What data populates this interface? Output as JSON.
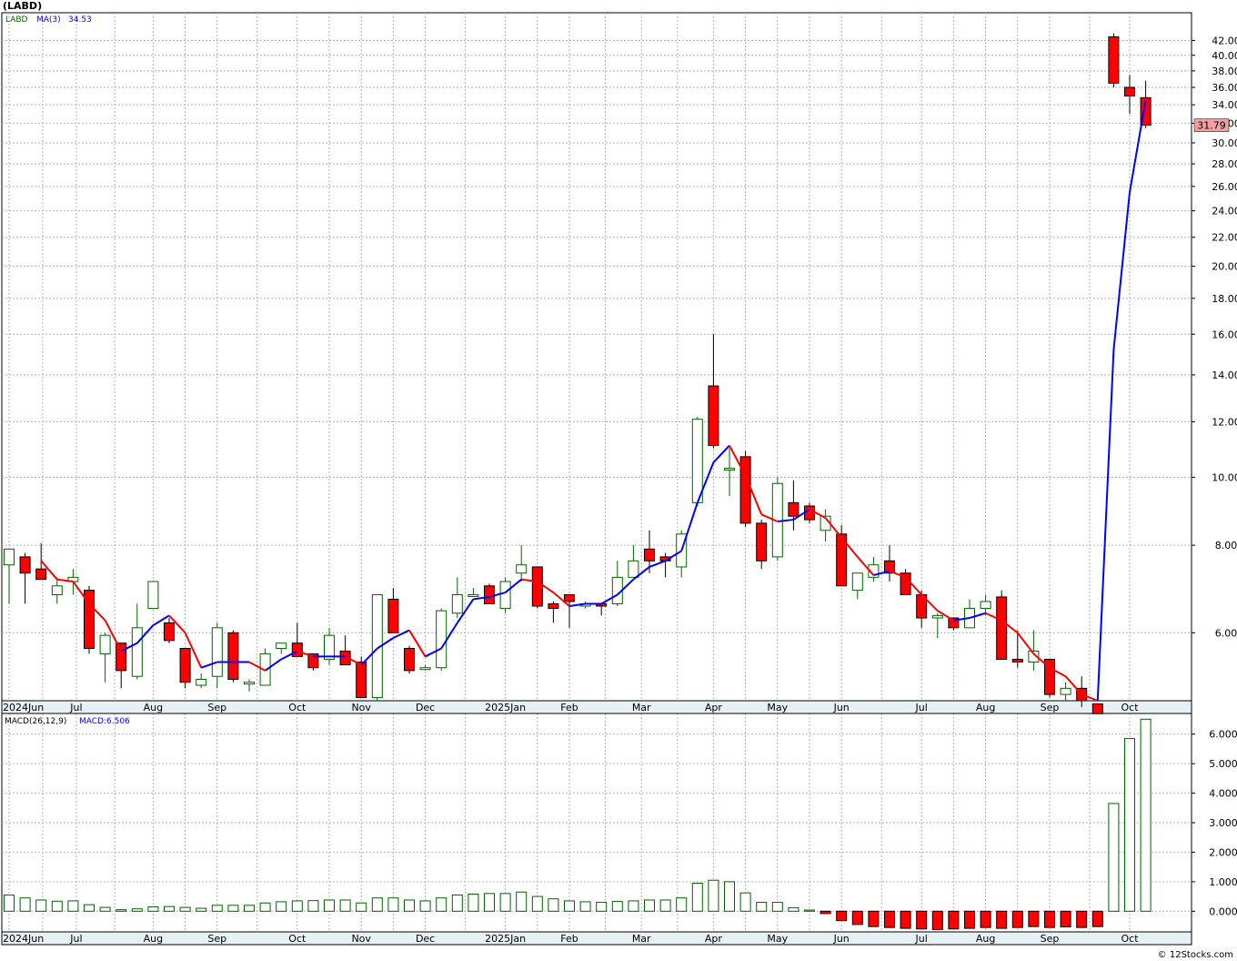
{
  "title": "(LABD)",
  "watermark": "© 12Stocks.com",
  "price_panel": {
    "legend_symbol": "LABD",
    "legend_ma_label": "MA(3)",
    "legend_ma_value": "34.53",
    "last_price_tag": "31.79"
  },
  "macd_panel": {
    "legend_label": "MACD(26,12,9)",
    "legend_value": "MACD:6.506"
  },
  "colors": {
    "up_candle": "#006400",
    "down_candle": "#ff0000",
    "ma_down": "#ff0000",
    "ma_up": "#0000ff",
    "macd_up": "#006400",
    "macd_down": "#ff0000",
    "last_tag_bg": "#f4a0a0",
    "grid": "#b4b4b4",
    "axis_strip": "#e6f0f5"
  },
  "x_axis_labels": [
    "2024Jun",
    "Jul",
    "Aug",
    "Sep",
    "Oct",
    "Nov",
    "Dec",
    "2025Jan",
    "Feb",
    "Mar",
    "Apr",
    "May",
    "Jun",
    "Jul",
    "Aug",
    "Sep",
    "Oct"
  ],
  "chart_data": [
    {
      "type": "candlestick",
      "title": "(LABD)",
      "scale": "log",
      "ylim": [
        4.8,
        46
      ],
      "y_ticks": [
        "6.00",
        "8.00",
        "10.00",
        "12.00",
        "14.00",
        "16.00",
        "18.00",
        "20.00",
        "22.00",
        "24.00",
        "26.00",
        "28.00",
        "30.00",
        "32.00",
        "34.00",
        "36.00",
        "38.00",
        "40.00",
        "42.00"
      ],
      "grid": true,
      "series_name": "LABD",
      "ma_name": "MA(3)",
      "candles": [
        {
          "o": 7.5,
          "h": 7.9,
          "l": 6.6,
          "c": 7.9
        },
        {
          "o": 7.7,
          "h": 7.8,
          "l": 6.6,
          "c": 7.3
        },
        {
          "o": 7.4,
          "h": 8.05,
          "l": 7.15,
          "c": 7.15
        },
        {
          "o": 6.8,
          "h": 7.2,
          "l": 6.6,
          "c": 7.0
        },
        {
          "o": 7.1,
          "h": 7.4,
          "l": 6.8,
          "c": 7.2
        },
        {
          "o": 6.9,
          "h": 7.0,
          "l": 5.6,
          "c": 5.7
        },
        {
          "o": 5.6,
          "h": 6.0,
          "l": 5.1,
          "c": 5.95
        },
        {
          "o": 5.8,
          "h": 5.8,
          "l": 5.0,
          "c": 5.3
        },
        {
          "o": 5.2,
          "h": 6.6,
          "l": 5.15,
          "c": 6.1
        },
        {
          "o": 6.5,
          "h": 7.1,
          "l": 6.5,
          "c": 7.1
        },
        {
          "o": 6.2,
          "h": 6.3,
          "l": 5.8,
          "c": 5.85
        },
        {
          "o": 5.7,
          "h": 5.7,
          "l": 5.0,
          "c": 5.1
        },
        {
          "o": 5.05,
          "h": 5.25,
          "l": 5.0,
          "c": 5.15
        },
        {
          "o": 5.2,
          "h": 6.2,
          "l": 5.0,
          "c": 6.1
        },
        {
          "o": 6.0,
          "h": 6.05,
          "l": 5.1,
          "c": 5.15
        },
        {
          "o": 5.1,
          "h": 5.15,
          "l": 4.95,
          "c": 5.1
        },
        {
          "o": 5.05,
          "h": 5.7,
          "l": 5.05,
          "c": 5.6
        },
        {
          "o": 5.7,
          "h": 5.8,
          "l": 5.6,
          "c": 5.8
        },
        {
          "o": 5.8,
          "h": 6.2,
          "l": 5.6,
          "c": 5.55
        },
        {
          "o": 5.6,
          "h": 5.6,
          "l": 5.3,
          "c": 5.35
        },
        {
          "o": 5.5,
          "h": 6.1,
          "l": 5.4,
          "c": 5.95
        },
        {
          "o": 5.65,
          "h": 5.95,
          "l": 5.4,
          "c": 5.4
        },
        {
          "o": 5.45,
          "h": 5.55,
          "l": 4.85,
          "c": 4.85
        },
        {
          "o": 4.85,
          "h": 6.8,
          "l": 4.8,
          "c": 6.8
        },
        {
          "o": 6.7,
          "h": 6.95,
          "l": 6.0,
          "c": 6.0
        },
        {
          "o": 5.7,
          "h": 5.75,
          "l": 5.25,
          "c": 5.3
        },
        {
          "o": 5.35,
          "h": 5.4,
          "l": 5.3,
          "c": 5.35
        },
        {
          "o": 5.35,
          "h": 6.5,
          "l": 5.3,
          "c": 6.45
        },
        {
          "o": 6.4,
          "h": 7.2,
          "l": 6.3,
          "c": 6.8
        },
        {
          "o": 6.8,
          "h": 6.95,
          "l": 6.75,
          "c": 6.8
        },
        {
          "o": 7.0,
          "h": 7.05,
          "l": 6.6,
          "c": 6.6
        },
        {
          "o": 6.5,
          "h": 7.2,
          "l": 6.4,
          "c": 7.1
        },
        {
          "o": 7.3,
          "h": 8.0,
          "l": 7.1,
          "c": 7.5
        },
        {
          "o": 7.45,
          "h": 7.45,
          "l": 6.5,
          "c": 6.55
        },
        {
          "o": 6.6,
          "h": 6.65,
          "l": 6.2,
          "c": 6.5
        },
        {
          "o": 6.8,
          "h": 6.8,
          "l": 6.1,
          "c": 6.65
        },
        {
          "o": 6.55,
          "h": 6.65,
          "l": 6.5,
          "c": 6.6
        },
        {
          "o": 6.6,
          "h": 6.6,
          "l": 6.35,
          "c": 6.55
        },
        {
          "o": 6.6,
          "h": 7.6,
          "l": 6.55,
          "c": 7.2
        },
        {
          "o": 7.2,
          "h": 8.0,
          "l": 7.2,
          "c": 7.6
        },
        {
          "o": 7.9,
          "h": 8.4,
          "l": 7.3,
          "c": 7.6
        },
        {
          "o": 7.7,
          "h": 7.8,
          "l": 7.2,
          "c": 7.6
        },
        {
          "o": 7.45,
          "h": 8.4,
          "l": 7.2,
          "c": 8.3
        },
        {
          "o": 9.2,
          "h": 12.2,
          "l": 9.1,
          "c": 12.1
        },
        {
          "o": 13.5,
          "h": 16.0,
          "l": 11.0,
          "c": 11.1
        },
        {
          "o": 10.3,
          "h": 11.0,
          "l": 9.4,
          "c": 10.3
        },
        {
          "o": 10.7,
          "h": 10.9,
          "l": 8.5,
          "c": 8.6
        },
        {
          "o": 8.6,
          "h": 8.7,
          "l": 7.4,
          "c": 7.6
        },
        {
          "o": 7.7,
          "h": 10.0,
          "l": 7.6,
          "c": 9.8
        },
        {
          "o": 9.2,
          "h": 9.9,
          "l": 8.4,
          "c": 8.8
        },
        {
          "o": 9.1,
          "h": 9.2,
          "l": 8.6,
          "c": 8.7
        },
        {
          "o": 8.4,
          "h": 9.0,
          "l": 8.1,
          "c": 8.8
        },
        {
          "o": 8.3,
          "h": 8.55,
          "l": 7.0,
          "c": 7.0
        },
        {
          "o": 6.9,
          "h": 7.3,
          "l": 6.7,
          "c": 7.3
        },
        {
          "o": 7.2,
          "h": 7.7,
          "l": 7.1,
          "c": 7.5
        },
        {
          "o": 7.6,
          "h": 8.0,
          "l": 7.1,
          "c": 7.3
        },
        {
          "o": 7.3,
          "h": 7.4,
          "l": 6.8,
          "c": 6.8
        },
        {
          "o": 6.8,
          "h": 6.9,
          "l": 6.1,
          "c": 6.3
        },
        {
          "o": 6.3,
          "h": 6.4,
          "l": 5.9,
          "c": 6.35
        },
        {
          "o": 6.3,
          "h": 6.3,
          "l": 6.05,
          "c": 6.1
        },
        {
          "o": 6.1,
          "h": 6.7,
          "l": 6.1,
          "c": 6.5
        },
        {
          "o": 6.5,
          "h": 6.8,
          "l": 6.35,
          "c": 6.65
        },
        {
          "o": 6.75,
          "h": 6.9,
          "l": 5.5,
          "c": 5.5
        },
        {
          "o": 5.5,
          "h": 6.05,
          "l": 5.35,
          "c": 5.45
        },
        {
          "o": 5.45,
          "h": 6.05,
          "l": 5.3,
          "c": 5.65
        },
        {
          "o": 5.5,
          "h": 5.5,
          "l": 4.85,
          "c": 4.9
        },
        {
          "o": 4.9,
          "h": 5.1,
          "l": 4.8,
          "c": 5.0
        },
        {
          "o": 5.0,
          "h": 5.2,
          "l": 4.7,
          "c": 4.8
        },
        {
          "o": 4.75,
          "h": 4.75,
          "l": 4.6,
          "c": 4.6
        },
        {
          "o": 42.5,
          "h": 43.0,
          "l": 36.0,
          "c": 36.5
        },
        {
          "o": 36.0,
          "h": 37.5,
          "l": 33.0,
          "c": 35.0
        },
        {
          "o": 34.8,
          "h": 36.8,
          "l": 31.5,
          "c": 31.79
        }
      ],
      "ma_values": [
        null,
        null,
        7.6,
        7.15,
        7.1,
        6.6,
        6.25,
        5.65,
        5.8,
        6.15,
        6.35,
        6.0,
        5.35,
        5.45,
        5.45,
        5.45,
        5.3,
        5.5,
        5.65,
        5.55,
        5.55,
        5.55,
        5.4,
        5.7,
        5.9,
        6.05,
        5.55,
        5.7,
        6.2,
        6.7,
        6.75,
        6.85,
        7.15,
        7.1,
        6.85,
        6.55,
        6.6,
        6.6,
        6.8,
        7.15,
        7.45,
        7.6,
        7.85,
        9.2,
        10.5,
        11.1,
        10.05,
        8.85,
        8.65,
        8.7,
        9.0,
        8.75,
        8.2,
        7.7,
        7.25,
        7.35,
        7.2,
        6.8,
        6.45,
        6.25,
        6.3,
        6.4,
        6.25,
        6.0,
        5.6,
        5.35,
        5.2,
        4.9,
        4.8,
        15.2,
        25.5,
        34.53
      ]
    },
    {
      "type": "bar",
      "title": "MACD(26,12,9)",
      "ylim": [
        -0.7,
        6.7
      ],
      "y_ticks": [
        "0.000",
        "1.000",
        "2.000",
        "3.000",
        "4.000",
        "5.000",
        "6.000"
      ],
      "grid": true,
      "values": [
        0.55,
        0.45,
        0.38,
        0.34,
        0.35,
        0.22,
        0.13,
        0.05,
        0.08,
        0.15,
        0.16,
        0.13,
        0.1,
        0.2,
        0.2,
        0.2,
        0.28,
        0.32,
        0.35,
        0.36,
        0.38,
        0.38,
        0.28,
        0.45,
        0.45,
        0.38,
        0.35,
        0.45,
        0.55,
        0.58,
        0.6,
        0.6,
        0.65,
        0.5,
        0.42,
        0.35,
        0.32,
        0.3,
        0.33,
        0.35,
        0.38,
        0.38,
        0.45,
        0.95,
        1.05,
        1.0,
        0.62,
        0.3,
        0.3,
        0.12,
        0.04,
        -0.08,
        -0.32,
        -0.45,
        -0.52,
        -0.55,
        -0.58,
        -0.6,
        -0.62,
        -0.6,
        -0.58,
        -0.55,
        -0.58,
        -0.55,
        -0.52,
        -0.55,
        -0.53,
        -0.55,
        -0.52,
        3.65,
        5.85,
        6.506
      ]
    }
  ]
}
